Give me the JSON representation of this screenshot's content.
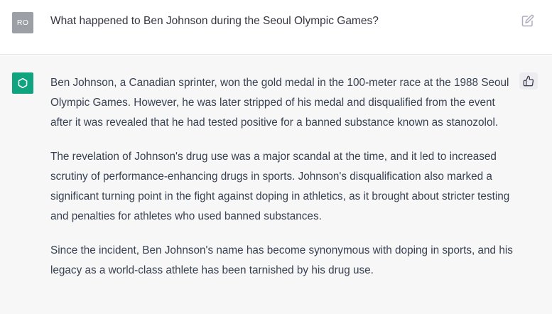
{
  "user": {
    "avatar_initials": "RO",
    "message": "What happened to Ben Johnson during the Seoul Olympic Games?"
  },
  "assistant": {
    "paragraphs": [
      "Ben Johnson, a Canadian sprinter, won the gold medal in the 100-meter race at the 1988 Seoul Olympic Games. However, he was later stripped of his medal and disqualified from the event after it was revealed that he had tested positive for a banned substance known as stanozolol.",
      "The revelation of Johnson's drug use was a major scandal at the time, and it led to increased scrutiny of performance-enhancing drugs in sports. Johnson's disqualification also marked a significant turning point in the fight against doping in athletics, as it brought about stricter testing and penalties for athletes who used banned substances.",
      "Since the incident, Ben Johnson's name has become synonymous with doping in sports, and his legacy as a world-class athlete has been tarnished by his drug use."
    ]
  },
  "icons": {
    "edit": "edit-icon",
    "thumbs_up": "thumbs-up-icon",
    "assistant_logo": "openai-logo-icon"
  },
  "colors": {
    "user_avatar": "#9aa0a6",
    "assistant_avatar": "#10a37f",
    "assistant_background": "#f7f7f8"
  }
}
